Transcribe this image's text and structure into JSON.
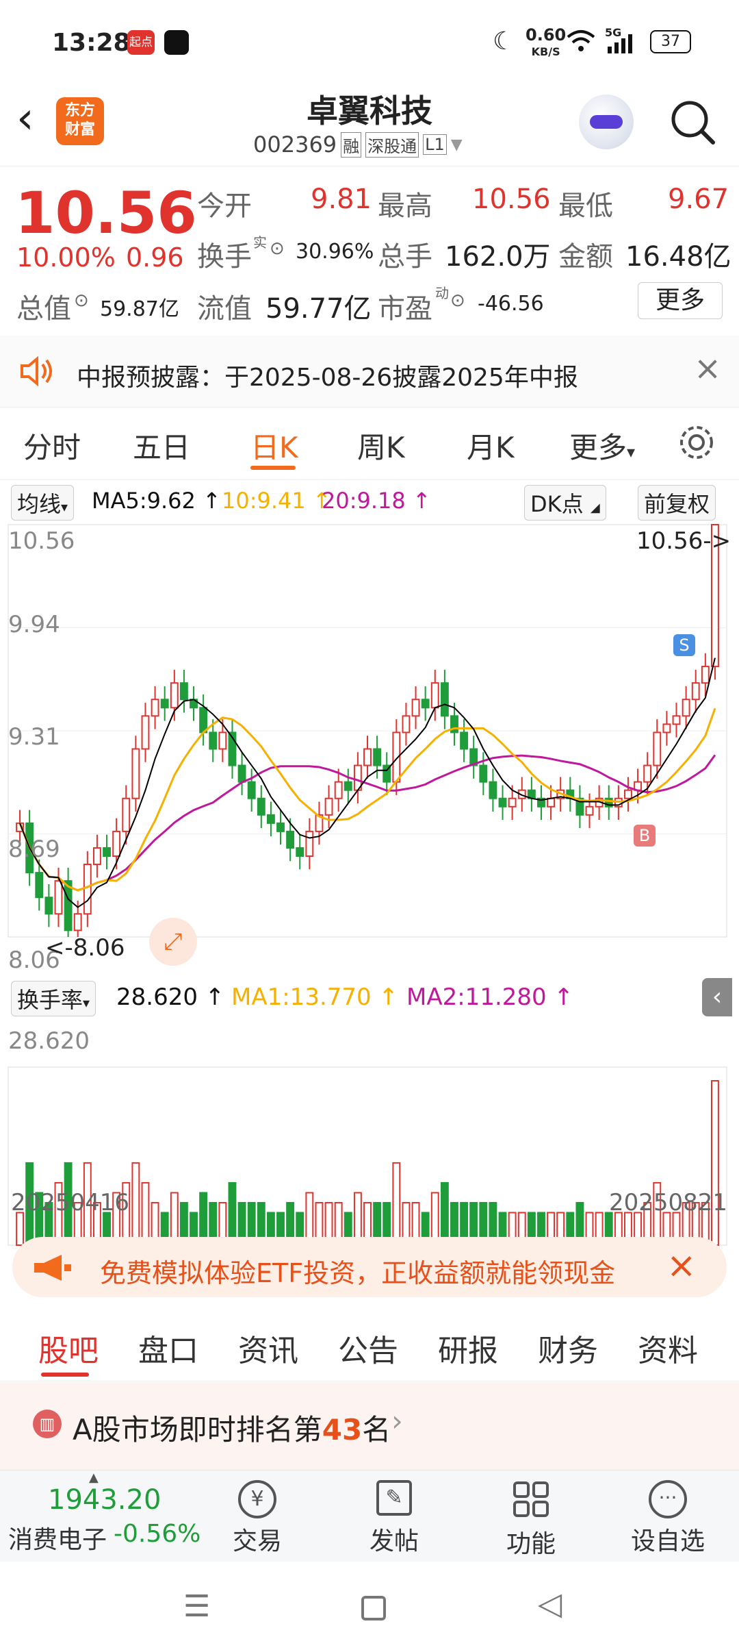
{
  "status_bar": {
    "time": "13:28",
    "app_badge": "起点",
    "net_speed_top": "0.60",
    "net_speed_unit": "KB/S",
    "network": "5G",
    "battery": "37"
  },
  "header": {
    "logo_text_top": "东方",
    "logo_text_bottom": "财富",
    "stock_name": "卓翼科技",
    "stock_code": "002369",
    "tag_margin": "融",
    "tag_connect": "深股通",
    "tag_level": "L1"
  },
  "quote": {
    "price": "10.56",
    "change_pct": "10.00%",
    "change_abs": "0.96",
    "open_label": "今开",
    "open_value": "9.81",
    "high_label": "最高",
    "high_value": "10.56",
    "low_label": "最低",
    "low_value": "9.67",
    "turnover_label": "换手",
    "turnover_sup": "实",
    "turnover_value": "30.96%",
    "volume_label": "总手",
    "volume_value": "162.0万",
    "amount_label": "金额",
    "amount_value": "16.48亿",
    "mktcap_label": "总值",
    "mktcap_value": "59.87亿",
    "float_label": "流值",
    "float_value": "59.77亿",
    "pe_label": "市盈",
    "pe_sup": "动",
    "pe_value": "-46.56",
    "more_button": "更多"
  },
  "notice": {
    "text": "中报预披露：于2025-08-26披露2025年中报"
  },
  "chart_tabs": [
    "分时",
    "五日",
    "日K",
    "周K",
    "月K",
    "更多"
  ],
  "active_tab": "日K",
  "chart": {
    "ma_selector": "均线",
    "ma5": "MA5:9.62",
    "ma10": "10:9.41",
    "ma20": "20:9.18",
    "dk_button": "DK点",
    "adjust_button": "前复权",
    "y_ticks": [
      "10.56",
      "9.94",
      "9.31",
      "8.69",
      "8.06"
    ],
    "latest_label": "10.56->",
    "low_label": "<-8.06",
    "sell_marker": "S",
    "buy_marker": "B",
    "indicator_selector": "换手率",
    "turnover_value": "28.620",
    "ma1": "MA1:13.770",
    "ma2": "MA2:11.280",
    "turnover_max": "28.620",
    "start_date": "20250416",
    "end_date": "20250821",
    "colors": {
      "up": "#e0332e",
      "down": "#1f9d3a",
      "ma5": "#000000",
      "ma10": "#f5b000",
      "ma20": "#c0189b"
    }
  },
  "chart_data": {
    "type": "candlestick",
    "x_start": "20250416",
    "x_end": "20250821",
    "ylim": [
      8.06,
      10.56
    ],
    "closes": [
      8.75,
      8.45,
      8.3,
      8.2,
      8.4,
      8.1,
      8.2,
      8.5,
      8.6,
      8.55,
      8.7,
      8.9,
      9.2,
      9.4,
      9.5,
      9.45,
      9.6,
      9.5,
      9.45,
      9.3,
      9.2,
      9.3,
      9.1,
      9.0,
      8.9,
      8.8,
      8.75,
      8.7,
      8.6,
      8.55,
      8.7,
      8.8,
      8.9,
      9.0,
      8.95,
      9.1,
      9.2,
      9.1,
      9.0,
      9.3,
      9.4,
      9.5,
      9.45,
      9.6,
      9.4,
      9.3,
      9.2,
      9.1,
      9.0,
      8.9,
      8.85,
      8.9,
      8.95,
      8.9,
      8.85,
      8.9,
      8.95,
      8.9,
      8.8,
      8.85,
      8.9,
      8.85,
      8.9,
      8.95,
      9.0,
      9.1,
      9.3,
      9.35,
      9.4,
      9.5,
      9.6,
      9.7,
      10.56
    ],
    "turnover_ma": {
      "MA1": 13.77,
      "MA2": 11.28
    },
    "turnover_latest": 28.62
  },
  "banner": {
    "text": "免费模拟体验ETF投资，正收益额就能领现金"
  },
  "bottom_tabs": [
    "股吧",
    "盘口",
    "资讯",
    "公告",
    "研报",
    "财务",
    "资料"
  ],
  "rank": {
    "prefix": "A股市场即时排名第",
    "number": "43",
    "suffix": "名"
  },
  "toolbar": {
    "index_value": "1943.20",
    "index_name": "消费电子",
    "index_change": "-0.56%",
    "items": [
      "交易",
      "发帖",
      "功能",
      "设自选"
    ]
  }
}
